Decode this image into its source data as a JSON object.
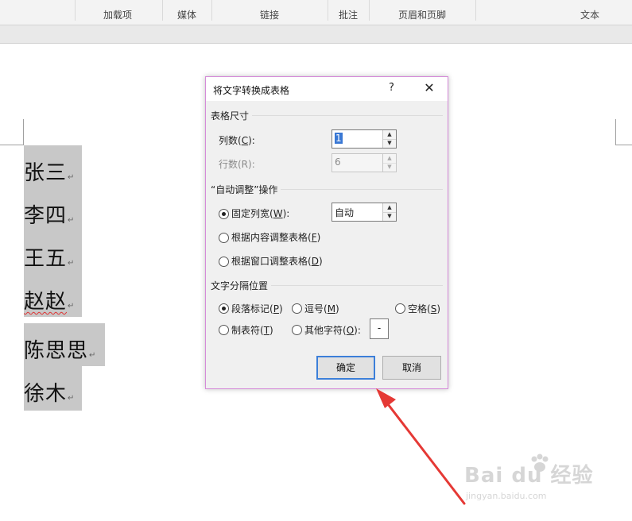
{
  "ribbon": {
    "groups": [
      "加载项",
      "媒体",
      "链接",
      "批注",
      "页眉和页脚",
      "文本"
    ]
  },
  "document": {
    "lines": [
      {
        "text": "张三",
        "mark": "↵"
      },
      {
        "text": "李四",
        "mark": "↵"
      },
      {
        "text": "王五",
        "mark": "↵"
      },
      {
        "text": "赵赵",
        "mark": "↵"
      },
      {
        "text": "陈思思",
        "mark": "↵"
      },
      {
        "text": "徐木",
        "mark": "↵"
      }
    ]
  },
  "dialog": {
    "title": "将文字转换成表格",
    "help": "?",
    "close": "✕",
    "table_size": {
      "heading": "表格尺寸",
      "columns_label": "列数(",
      "columns_key": "C",
      "columns_suffix": "):",
      "columns_value": "1",
      "rows_label": "行数(R):",
      "rows_value": "6"
    },
    "autofit": {
      "heading": "“自动调整”操作",
      "fixed_label": "固定列宽(",
      "fixed_key": "W",
      "fixed_suffix": "):",
      "fixed_value": "自动",
      "content_label": "根据内容调整表格(",
      "content_key": "F",
      "content_suffix": ")",
      "window_label": "根据窗口调整表格(",
      "window_key": "D",
      "window_suffix": ")"
    },
    "separator": {
      "heading": "文字分隔位置",
      "paragraph_label": "段落标记(",
      "paragraph_key": "P",
      "paragraph_suffix": ")",
      "comma_label": "逗号(",
      "comma_key": "M",
      "comma_suffix": ")",
      "space_label": "空格(",
      "space_key": "S",
      "space_suffix": ")",
      "tab_label": "制表符(",
      "tab_key": "T",
      "tab_suffix": ")",
      "other_label": "其他字符(",
      "other_key": "O",
      "other_suffix": "):",
      "other_value": "-"
    },
    "ok_label": "确定",
    "cancel_label": "取消"
  },
  "watermark": {
    "brand": "Bai du 经验",
    "site": "jingyan.baidu.com"
  },
  "colors": {
    "arrow": "#e53935",
    "selection": "#c8c8c8",
    "dialog_border": "#d58bd9",
    "primary_button_border": "#3c7fd9"
  }
}
